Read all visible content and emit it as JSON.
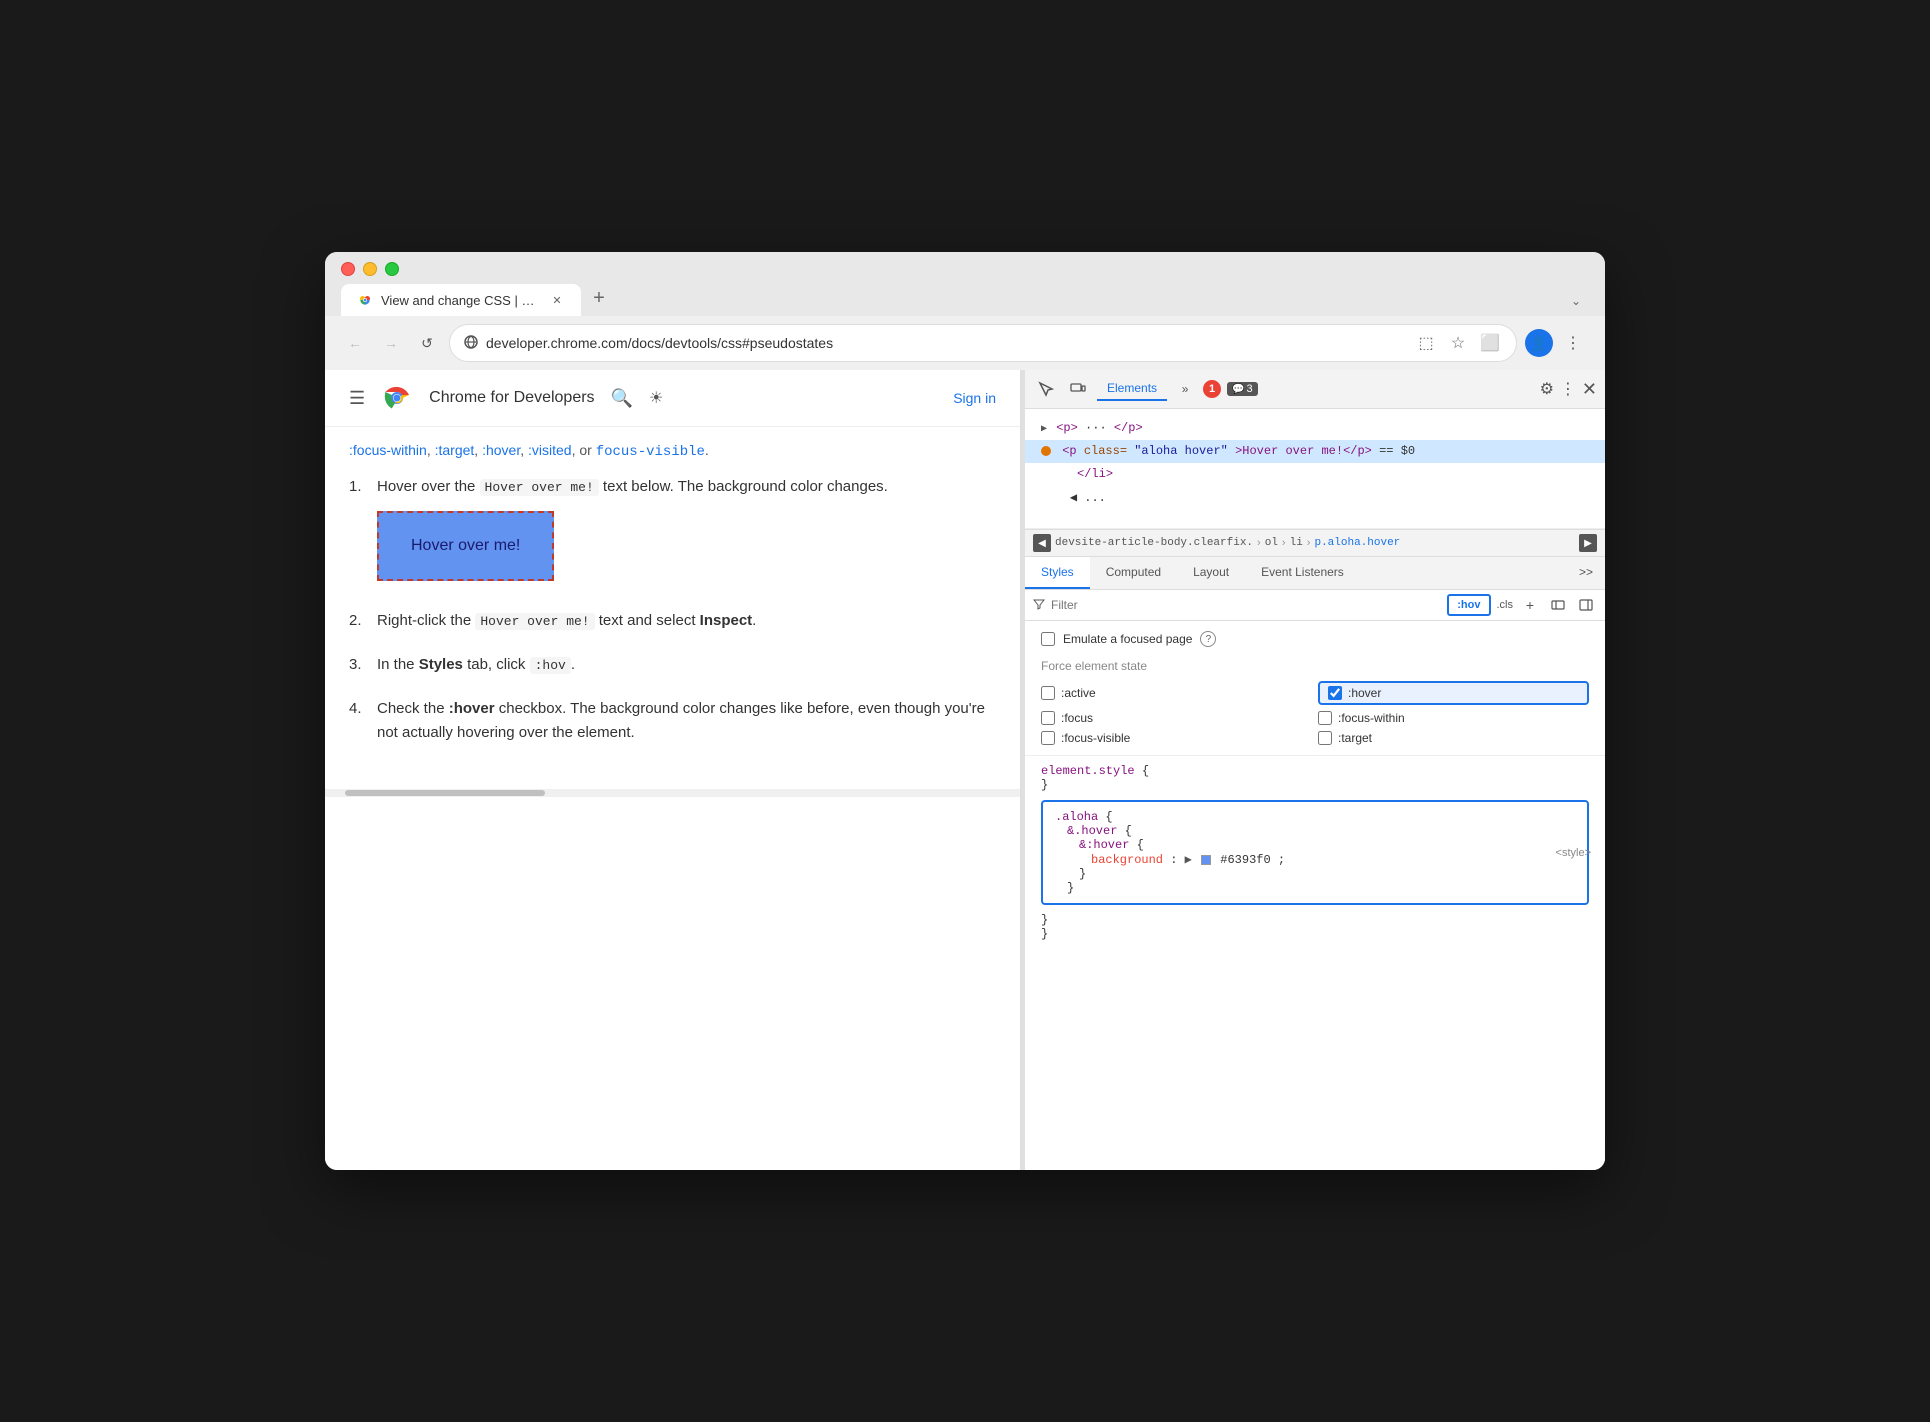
{
  "browser": {
    "tab": {
      "title": "View and change CSS | Chr",
      "favicon": "chrome"
    },
    "tab_new_label": "+",
    "tab_dropdown_label": "⌄",
    "nav": {
      "back_label": "←",
      "forward_label": "→",
      "refresh_label": "↺",
      "url": "developer.chrome.com/docs/devtools/css#pseudostates",
      "cast_label": "⬚",
      "bookmark_label": "★",
      "extension_label": "⬜",
      "profile_label": "👤",
      "menu_label": "⋮"
    }
  },
  "site_header": {
    "hamburger_label": "☰",
    "title": "Chrome for Developers",
    "search_label": "🔍",
    "theme_label": "☀",
    "signin_label": "Sign in"
  },
  "article": {
    "top_text_1": ":focus-within",
    "top_text_2": ", ",
    "top_text_3": ":target",
    "top_text_4": ", ",
    "top_text_5": ":hover",
    "top_text_6": ", ",
    "top_text_7": ":visited",
    "top_text_8": ",",
    "top_text_9": " or ",
    "focus_visible": "focus-visible",
    "dot": ".",
    "steps": [
      {
        "num": "1.",
        "text_before": "Hover over the ",
        "code": "Hover over me!",
        "text_after": " text below. The background color changes."
      },
      {
        "num": "2.",
        "text_before": "Right-click the ",
        "code": "Hover over me!",
        "text_after": " text and select ",
        "bold": "Inspect",
        "end": "."
      },
      {
        "num": "3.",
        "text_before": "In the ",
        "bold1": "Styles",
        "text_mid": " tab, click ",
        "code2": ":hov",
        "text_after": "."
      },
      {
        "num": "4.",
        "text_before": "Check the ",
        "bold": ":hover",
        "text_after": " checkbox. The background color changes like before, even though you're not actually hovering over the element."
      }
    ],
    "hover_box_label": "Hover over me!"
  },
  "devtools": {
    "tools": {
      "inspect_label": "⊹",
      "device_label": "⬜",
      "elements_tab": "Elements",
      "more_label": "»",
      "error_count": "1",
      "warning_count": "3",
      "settings_label": "⚙",
      "kebab_label": "⋮",
      "close_label": "✕"
    },
    "dom": {
      "line1": "▶ <p> ··· </p>",
      "line2_before": "<p class=\"",
      "line2_class": "aloha hover",
      "line2_after": "\">Hover over me!</p> == $0",
      "line3": "</li>",
      "line4": "◀ ..."
    },
    "breadcrumb": {
      "prev_label": "◀",
      "next_label": "▶",
      "items": [
        "devsite-article-body.clearfix.",
        "ol",
        "li",
        "p.aloha.hover"
      ]
    },
    "styles_tabs": [
      "Styles",
      "Computed",
      "Layout",
      "Event Listeners",
      ">>"
    ],
    "filter": {
      "placeholder": "Filter",
      "hov_label": ":hov",
      "cls_label": ".cls",
      "add_label": "+",
      "toggle_label": "⬚",
      "sidebar_label": "⬚"
    },
    "emulate": {
      "label": "Emulate a focused page",
      "help": "?"
    },
    "force_state": {
      "label": "Force element state",
      "states": [
        {
          "id": "active",
          "label": ":active",
          "checked": false
        },
        {
          "id": "hover",
          "label": ":hover",
          "checked": true
        },
        {
          "id": "focus",
          "label": ":focus",
          "checked": false
        },
        {
          "id": "focus-within",
          "label": ":focus-within",
          "checked": false
        },
        {
          "id": "focus-visible",
          "label": ":focus-visible",
          "checked": false
        },
        {
          "id": "target",
          "label": ":target",
          "checked": false
        }
      ]
    },
    "css_rules": {
      "element_style": "element.style {",
      "element_close": "}",
      "aloha_block": {
        "selector": ".aloha {",
        "inner_selector": "&.hover {",
        "pseudo_selector": "&:hover {",
        "prop": "background",
        "colon": ":",
        "arrow": "▶",
        "color_value": "#6393f0",
        "semicolon": ";",
        "close1": "}",
        "close2": "}",
        "close3": "}"
      },
      "style_source": "<style>"
    },
    "colors": {
      "accent_blue": "#1a73e8",
      "hover_blue": "#6393f0",
      "error_red": "#ea4335"
    }
  }
}
